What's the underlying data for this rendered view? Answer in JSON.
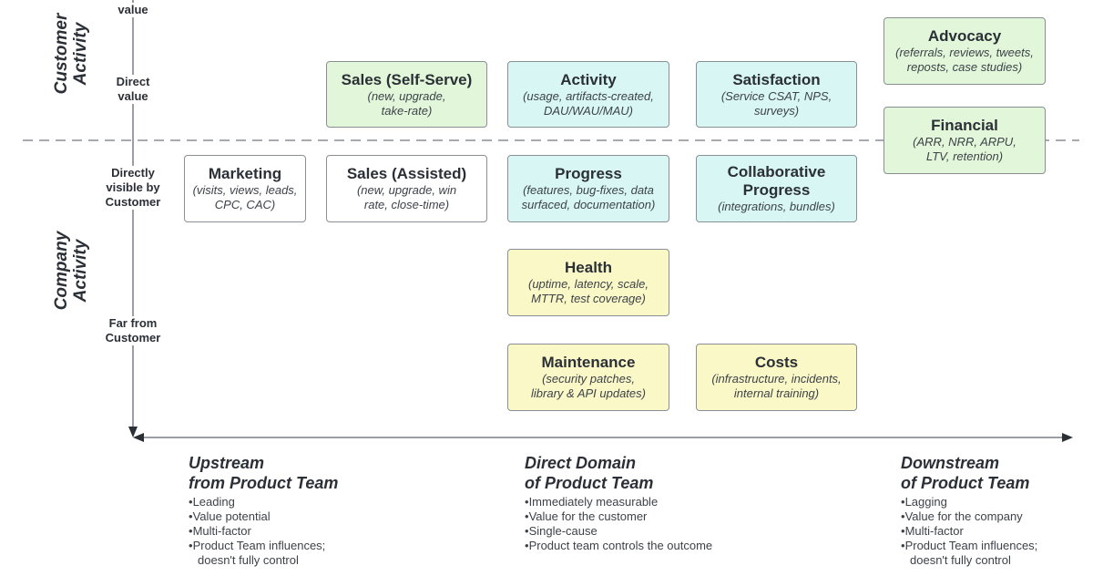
{
  "side_labels": {
    "customer": "Customer Activity",
    "company": "Company Activity"
  },
  "y_axis_labels": {
    "top_clipped": "value",
    "direct": "Direct value",
    "directly_visible": "Directly visible by Customer",
    "far": "Far from Customer"
  },
  "boxes": {
    "sales_self_serve": {
      "title": "Sales (Self-Serve)",
      "sub": "(new, upgrade, take-rate)"
    },
    "activity": {
      "title": "Activity",
      "sub": "(usage, artifacts-created, DAU/WAU/MAU)"
    },
    "satisfaction": {
      "title": "Satisfaction",
      "sub": "(Service CSAT, NPS, surveys)"
    },
    "advocacy": {
      "title": "Advocacy",
      "sub": "(referrals, reviews, tweets, reposts, case studies)"
    },
    "financial": {
      "title": "Financial",
      "sub": "(ARR, NRR, ARPU, LTV, retention)"
    },
    "marketing": {
      "title": "Marketing",
      "sub": "(visits, views, leads, CPC, CAC)"
    },
    "sales_assisted": {
      "title": "Sales (Assisted)",
      "sub": "(new, upgrade, win rate, close-time)"
    },
    "progress": {
      "title": "Progress",
      "sub": "(features, bug-fixes, data surfaced, documentation)"
    },
    "collab_progress": {
      "title": "Collaborative Progress",
      "sub": "(integrations, bundles)"
    },
    "health": {
      "title": "Health",
      "sub": "(uptime, latency, scale, MTTR, test coverage)"
    },
    "maintenance": {
      "title": "Maintenance",
      "sub": "(security patches, library & API updates)"
    },
    "costs": {
      "title": "Costs",
      "sub": "(infrastructure, incidents, internal training)"
    }
  },
  "colors": {
    "green": "#e2f7da",
    "cyan": "#d8f7f4",
    "yellow": "#fbf8c8",
    "white": "#ffffff",
    "axis": "#6b7078"
  },
  "legends": {
    "upstream": {
      "title_line1": "Upstream",
      "title_line2": "from Product Team",
      "bullets": [
        "Leading",
        "Value potential",
        "Multi-factor",
        "Product Team influences; doesn't fully control"
      ]
    },
    "direct": {
      "title_line1": "Direct Domain",
      "title_line2": "of Product Team",
      "bullets": [
        "Immediately measurable",
        "Value for the customer",
        "Single-cause",
        "Product team controls the outcome"
      ]
    },
    "downstream": {
      "title_line1": "Downstream",
      "title_line2": "of Product Team",
      "bullets": [
        "Lagging",
        "Value for the company",
        "Multi-factor",
        "Product Team influences; doesn't fully control"
      ]
    }
  }
}
